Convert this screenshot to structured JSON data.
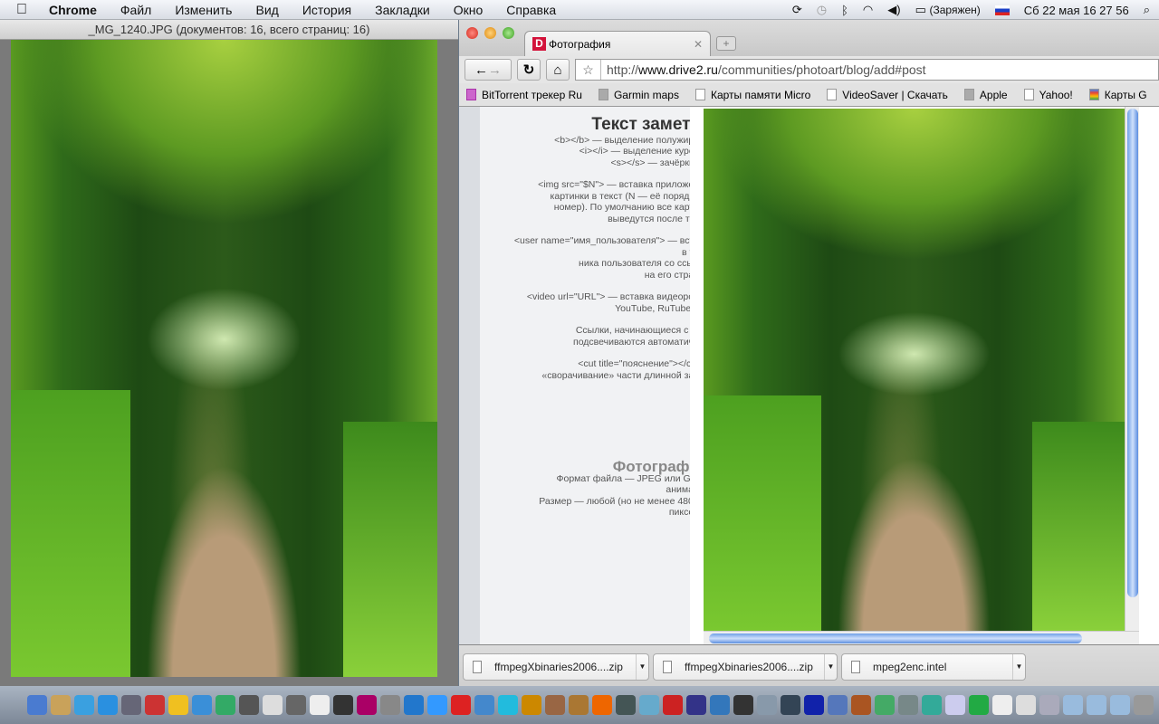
{
  "menubar": {
    "app": "Chrome",
    "items": [
      "Файл",
      "Изменить",
      "Вид",
      "История",
      "Закладки",
      "Окно",
      "Справка"
    ],
    "battery": "(Заряжен)",
    "datetime": "Сб 22 мая  16 27 56"
  },
  "preview": {
    "title": "_MG_1240.JPG (документов: 16, всего страниц: 16)"
  },
  "browser": {
    "tab": {
      "favicon": "D",
      "title": "Фотография"
    },
    "url_domain": "www.drive2.ru",
    "url_prefix": "http://",
    "url_path": "/communities/photoart/blog/add#post",
    "bookmarks": [
      "BitTorrent трекер Ru",
      "Garmin maps",
      "Карты памяти Micro",
      "VideoSaver | Скачать",
      "Apple",
      "Yahoo!",
      "Карты G"
    ],
    "panel": {
      "heading": "Текст заметк",
      "paragraphs": [
        "<b></b> — выделение полужирн\n<i></i> — выделение курси\n<s></s> — зачёркну",
        "<img src=\"$N\"> — вставка приложен\nкартинки в текст (N — её порядко\nномер). По умолчанию все карти\nвыведутся после тек",
        "<user name=\"имя_пользователя\"> — вста\nв те\nника пользователя со ссыл\nна его стран",
        "<video url=\"URL\"> — вставка видеорол\nYouTube, RuTube и",
        "Ссылки, начинающиеся с ht\nподсвечиваются автоматиче",
        "<cut title=\"пояснение\"></cut\n«сворачивание» части длинной зап"
      ],
      "photo_heading": "Фотографи",
      "photo_text": "Формат файла — JPEG или GIF\nанимац\nРазмер — любой (но не менее 480×\nпиксел"
    },
    "downloads": [
      "ffmpegXbinaries2006....zip",
      "ffmpegXbinaries2006....zip",
      "mpeg2enc.intel"
    ]
  },
  "colors": {
    "accent": "#d3123a",
    "scroll": "#6fa0e8"
  }
}
